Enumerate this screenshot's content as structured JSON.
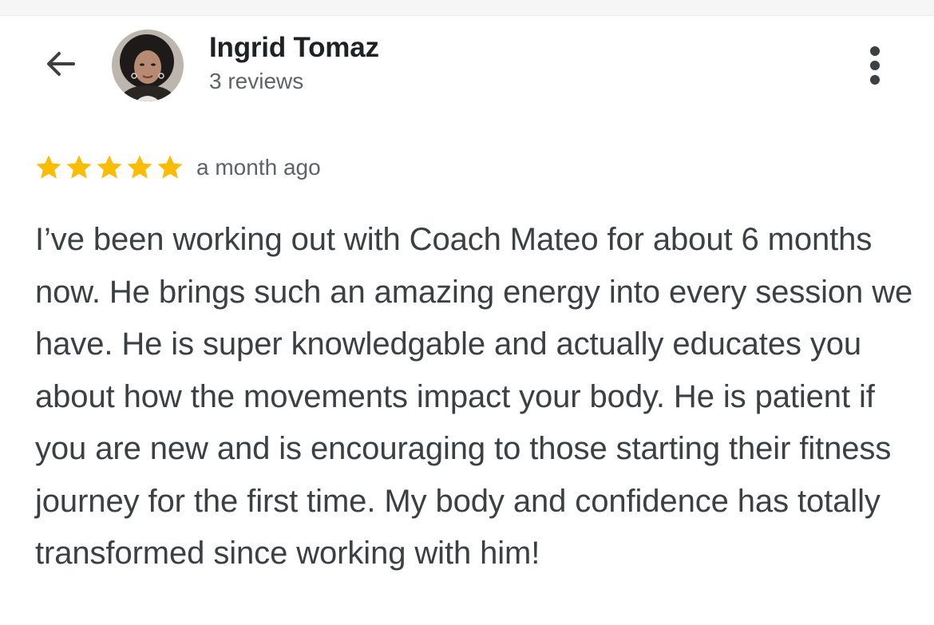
{
  "header": {
    "back_icon": "arrow-left-icon",
    "reviewer_name": "Ingrid Tomaz",
    "review_count": "3 reviews",
    "more_icon": "more-vertical-icon"
  },
  "review": {
    "rating": 5,
    "rating_max": 5,
    "star_color": "#fbbc04",
    "date": "a month ago",
    "text": "I’ve been working out with Coach Mateo for about 6 months now. He brings such an amazing energy into every session we have. He is super knowledgable and actually educates you about how the movements impact your body. He is patient if you are new and is encouraging to those starting their fitness journey for the first time. My body and confidence has totally transformed since working with him!"
  },
  "colors": {
    "name": "#202124",
    "secondary_text": "#5f6368",
    "body_text": "#3c4043"
  }
}
